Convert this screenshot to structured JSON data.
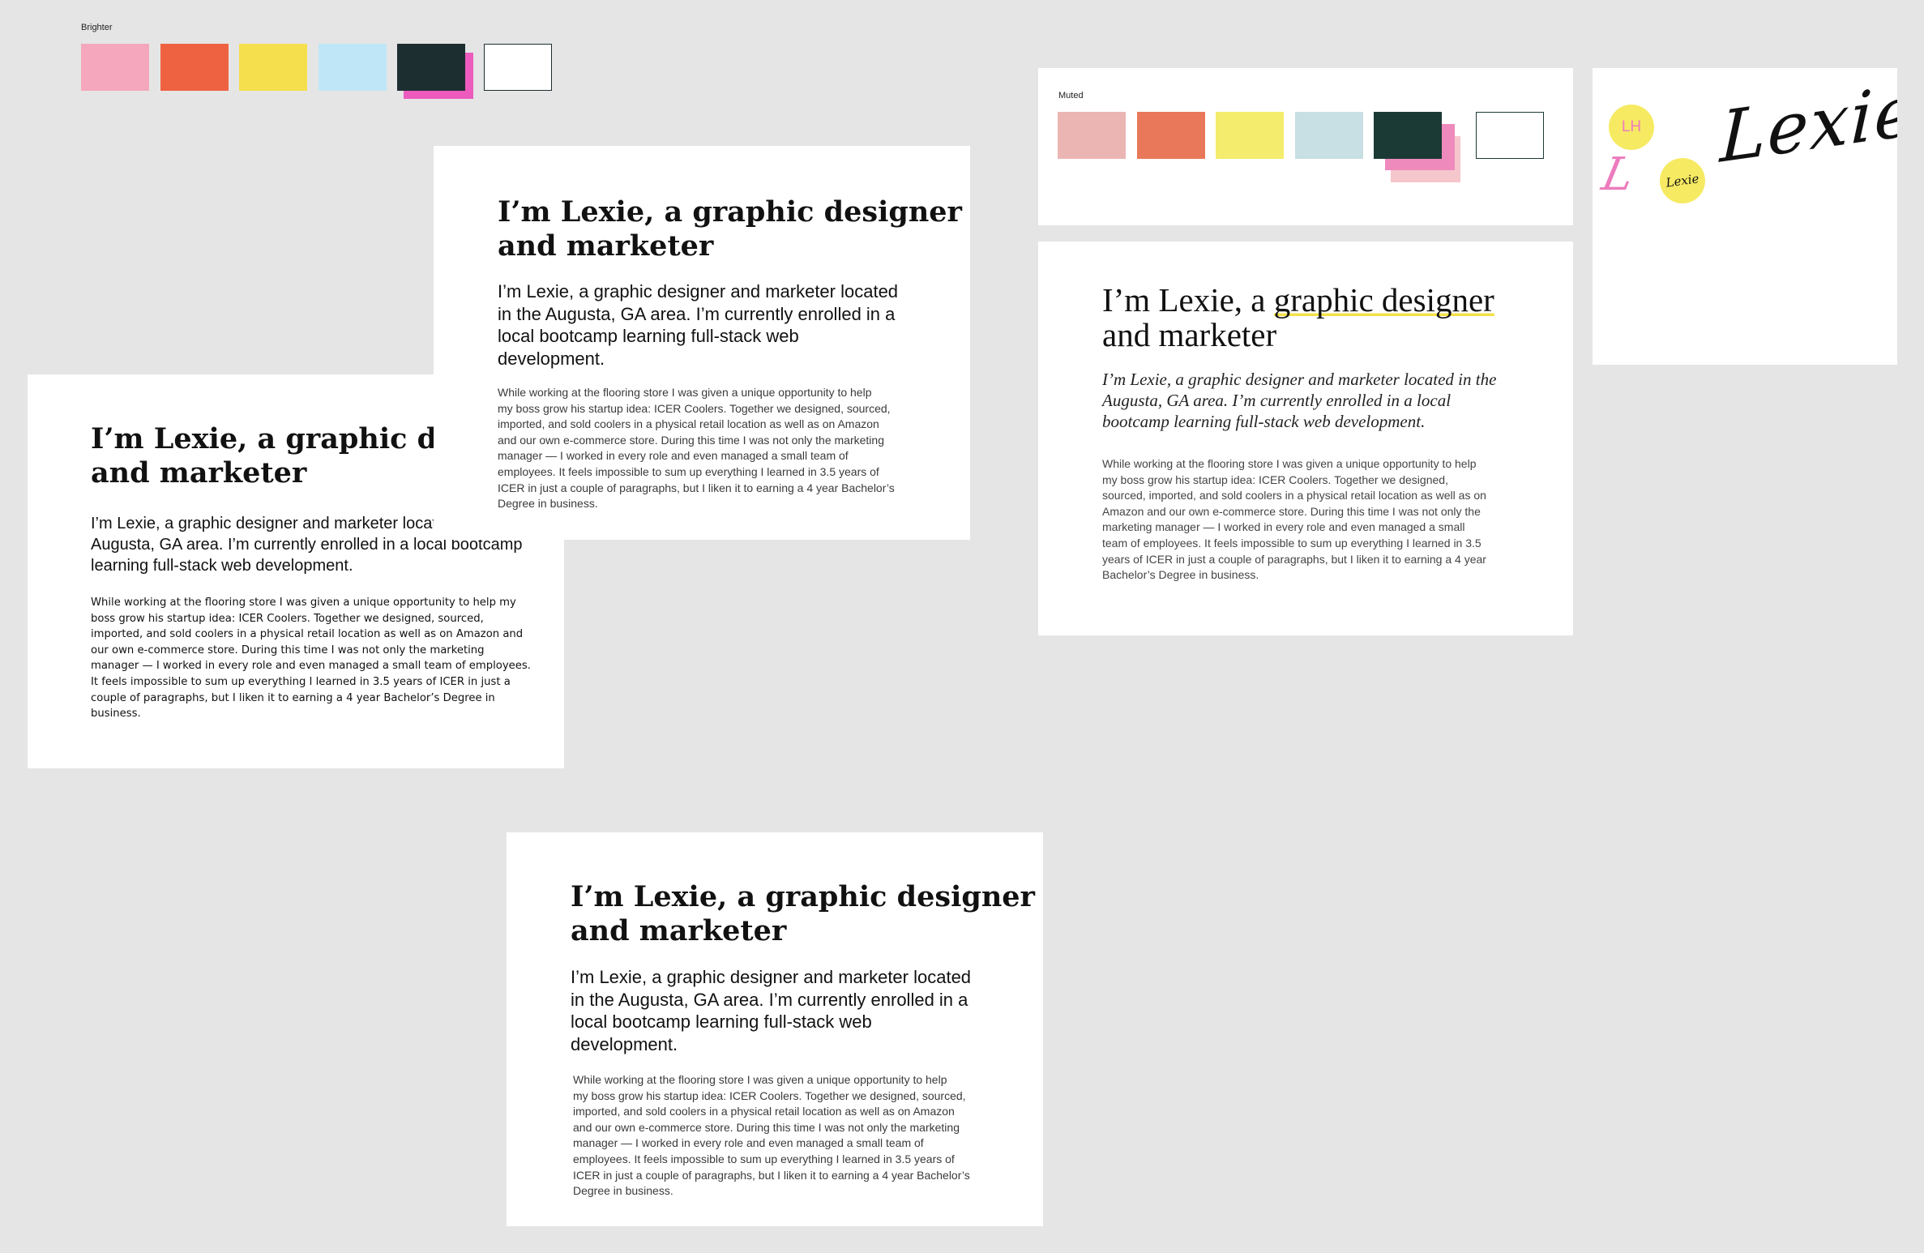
{
  "palettes": {
    "brighter": {
      "label": "Brighter",
      "colors": [
        "#f4a7bd",
        "#ef6241",
        "#f6df4d",
        "#bfe6f7",
        "#1d2e31",
        "#ffffff"
      ],
      "shadow_color": "#ec5bbd"
    },
    "muted": {
      "label": "Muted",
      "colors": [
        "#ebb5b3",
        "#e9785a",
        "#f4ec6c",
        "#c8dfe3",
        "#1c3a35",
        "#ffffff"
      ],
      "shadow_colors": [
        "#ef8abd",
        "#f5c6cc"
      ]
    }
  },
  "logo_card": {
    "monogram": "LH",
    "script_initial": "L",
    "small_wordmark": "Lexie",
    "wordmark": "Lexie",
    "badge_color": "#f6ea62",
    "monogram_color": "#ec7cbd",
    "script_color": "#ec7cbd",
    "ink_color": "#111111"
  },
  "copy": {
    "headline_line1": "I’m Lexie, a graphic designer",
    "headline_line2": "and marketer",
    "lora_line1_prefix": "I’m Lexie, a ",
    "lora_line1_highlight": "graphic designer",
    "lead_a_1": "I’m Lexie, a graphic designer and marketer located",
    "lead_a_2": "in the Augusta, GA area. I’m currently enrolled in a",
    "lead_a_3": "local bootcamp learning full-stack web",
    "lead_a_4": "development.",
    "lead_b_1": "I’m Lexie, a graphic designer and marketer located",
    "lead_b_2": "Augusta, GA area. I’m currently enrolled in a local bootcamp",
    "lead_b_3": "learning full-stack web development.",
    "lead_c_1": "I’m Lexie, a graphic designer and marketer located in the",
    "lead_c_2": "Augusta, GA area. I’m currently enrolled in a local",
    "lead_c_3": "bootcamp learning full-stack web development.",
    "body_a": [
      "While working at the flooring store I was given a unique opportunity to help",
      "my boss grow his startup idea: ICER Coolers. Together we designed, sourced,",
      "imported, and sold coolers in a physical retail location as well as on Amazon",
      "and our own e-commerce store. During this time I was not only the marketing",
      "manager — I worked in every role and even managed a small team of",
      "employees. It feels impossible to sum up everything I learned in 3.5 years of",
      "ICER in just a couple of paragraphs, but I liken it to earning a 4 year Bachelor’s",
      "Degree in business."
    ],
    "body_b": [
      "While working at the flooring store I was given a unique opportunity to help my",
      "boss grow his startup idea: ICER Coolers. Together we designed, sourced,",
      "imported, and sold coolers in a physical retail location as well as on Amazon and",
      "our own e-commerce store. During this time I was not only the marketing",
      "manager — I worked in every role and even managed a small team of employees.",
      "It feels impossible to sum up everything I learned in 3.5 years of ICER in just a",
      "couple of paragraphs, but I liken it to earning a 4 year Bachelor’s Degree in",
      "business."
    ],
    "body_c": [
      "While working at the flooring store I was given a unique opportunity to help",
      "my boss grow his startup idea: ICER Coolers. Together we designed,",
      "sourced, imported, and sold coolers in a physical retail location as well as on",
      "Amazon and our own e-commerce store. During this time I was not only the",
      "marketing manager — I worked in every role and even managed a small",
      "team of employees. It feels impossible to sum up everything I learned in 3.5",
      "years of ICER in just a couple of paragraphs, but I liken it to earning a 4 year",
      "Bachelor’s Degree in business."
    ]
  }
}
